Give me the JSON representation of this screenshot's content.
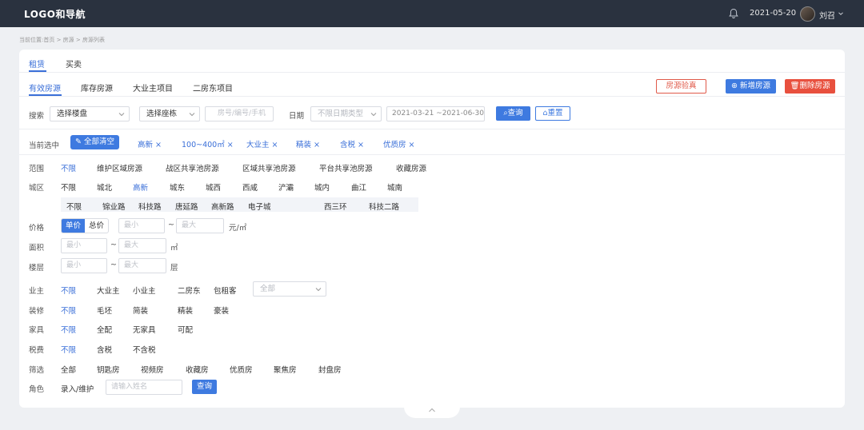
{
  "topbar": {
    "logo": "LOGO和导航",
    "date": "2021-05-20",
    "user": "刘召"
  },
  "breadcrumb": "当前位置:首页 > 房源 > 房源列表",
  "main_tabs": [
    "租赁",
    "买卖"
  ],
  "sub_tabs": [
    "有效房源",
    "库存房源",
    "大业主项目",
    "二房东项目"
  ],
  "actions": {
    "inspect": "房源验真",
    "add": "新增房源",
    "delete": "删除房源"
  },
  "search": {
    "label": "搜索",
    "building": "选择楼盘",
    "block": "选择座栋",
    "house_no_placeholder": "房号/编号/手机",
    "date_label": "日期",
    "date_type": "不限日期类型",
    "date_range": "2021-03-21 ~2021-06-30",
    "query": "查询",
    "reset": "重置"
  },
  "current": {
    "label": "当前选中",
    "clear": "全部清空",
    "chips": [
      "高新",
      "100~400㎡",
      "大业主",
      "精装",
      "含税",
      "优质房"
    ]
  },
  "filters": {
    "range": {
      "label": "范围",
      "options": [
        "不限",
        "维护区域房源",
        "战区共享池房源",
        "区域共享池房源",
        "平台共享池房源",
        "收藏房源"
      ]
    },
    "district": {
      "label": "城区",
      "options": [
        "不限",
        "城北",
        "高新",
        "城东",
        "城西",
        "西咸",
        "浐灞",
        "城内",
        "曲江",
        "城南"
      ]
    },
    "subdistrict": {
      "options": [
        "不限",
        "锦业路",
        "科技路",
        "唐延路",
        "高新路",
        "电子城",
        "西三环",
        "科技二路"
      ]
    },
    "price": {
      "label": "价格",
      "unit_price": "单价",
      "total_price": "总价",
      "min": "最小",
      "max": "最大",
      "tilde": "~",
      "unit": "元/㎡"
    },
    "area": {
      "label": "面积",
      "min": "最小",
      "max": "最大",
      "tilde": "~",
      "unit": "㎡"
    },
    "floor": {
      "label": "楼层",
      "min": "最小",
      "max": "最大",
      "tilde": "~",
      "unit": "层"
    },
    "owner": {
      "label": "业主",
      "options": [
        "不限",
        "大业主",
        "小业主",
        "二房东",
        "包租客"
      ],
      "select": "全部"
    },
    "decor": {
      "label": "装修",
      "options": [
        "不限",
        "毛坯",
        "简装",
        "精装",
        "豪装"
      ]
    },
    "furniture": {
      "label": "家具",
      "options": [
        "不限",
        "全配",
        "无家具",
        "可配"
      ]
    },
    "tax": {
      "label": "税费",
      "options": [
        "不限",
        "含税",
        "不含税"
      ]
    },
    "screen": {
      "label": "筛选",
      "options": [
        "全部",
        "钥匙房",
        "视频房",
        "收藏房",
        "优质房",
        "聚焦房",
        "封盘房"
      ]
    },
    "role": {
      "label": "角色",
      "role_select": "录入/维护",
      "name_placeholder": "请输入姓名",
      "query": "查询"
    }
  },
  "colors": {
    "topbar": "#2a323f",
    "accent": "#3e7ae0",
    "danger": "#e8503e"
  }
}
